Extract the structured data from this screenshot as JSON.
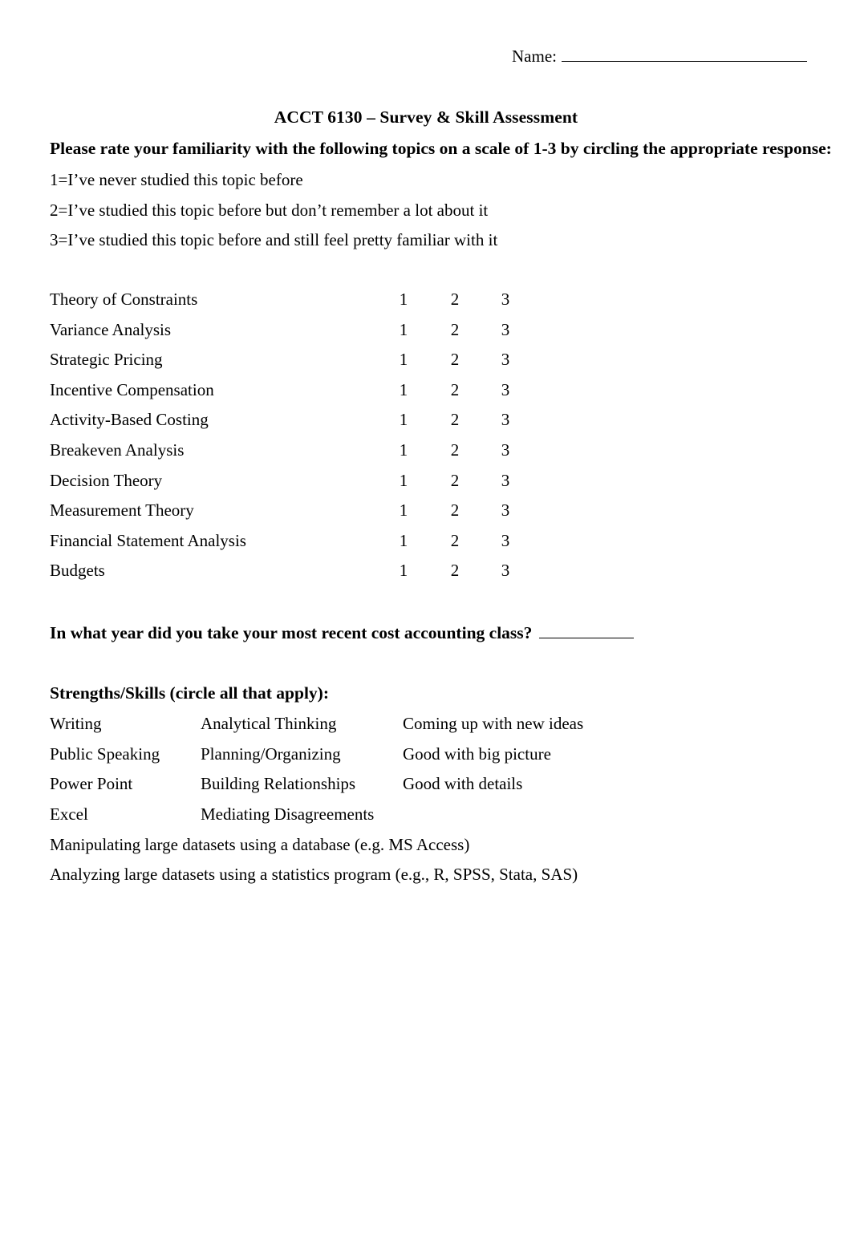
{
  "header": {
    "name_label": "Name:",
    "name_value": ""
  },
  "title": "ACCT 6130 – Survey & Skill Assessment",
  "instructions": {
    "lead": "Please rate your familiarity with the following topics on a scale of 1-3 by circling the appropriate response:",
    "scale": [
      "1=I’ve never studied this topic before",
      "2=I’ve studied this topic before but don’t remember a lot about it",
      "3=I’ve studied this topic before and still feel pretty familiar with it"
    ]
  },
  "rating_options": [
    "1",
    "2",
    "3"
  ],
  "topics": [
    "Theory of Constraints",
    "Variance Analysis",
    "Strategic Pricing",
    "Incentive Compensation",
    "Activity-Based Costing",
    "Breakeven Analysis",
    "Decision Theory",
    "Measurement Theory",
    "Financial Statement Analysis",
    "Budgets"
  ],
  "year_question": {
    "text": "In what year did you take your most recent cost accounting class?",
    "answer": ""
  },
  "skills": {
    "heading": "Strengths/Skills (circle all that apply):",
    "rows": [
      [
        "Writing",
        "Analytical Thinking",
        "Coming up with new ideas"
      ],
      [
        "Public Speaking",
        "Planning/Organizing",
        "Good with big picture"
      ],
      [
        "Power Point",
        "Building Relationships",
        "Good with details"
      ],
      [
        "Excel",
        "Mediating Disagreements",
        ""
      ]
    ],
    "wide_items": [
      "Manipulating large datasets using a database (e.g. MS Access)",
      "Analyzing large datasets using a statistics program (e.g., R, SPSS, Stata, SAS)"
    ]
  }
}
